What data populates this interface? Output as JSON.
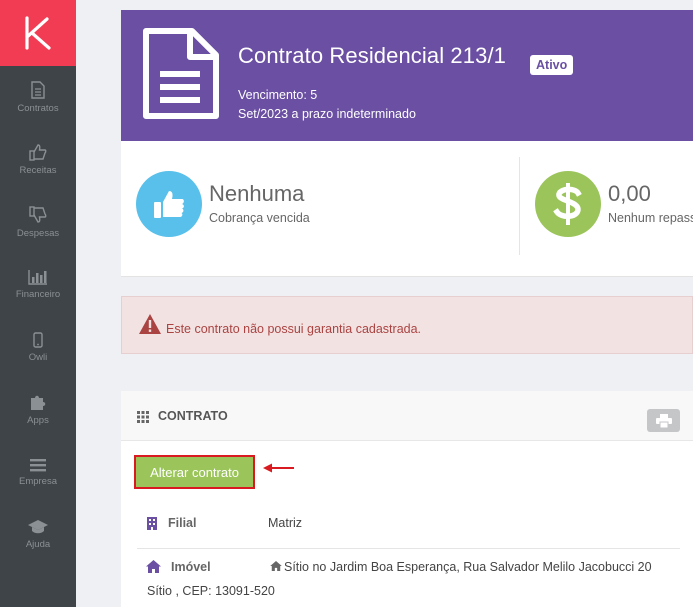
{
  "sidebar": {
    "items": [
      {
        "label": "Contratos",
        "icon": "document-icon"
      },
      {
        "label": "Receitas",
        "icon": "thumbs-up-icon"
      },
      {
        "label": "Despesas",
        "icon": "thumbs-down-icon"
      },
      {
        "label": "Financeiro",
        "icon": "bar-chart-icon"
      },
      {
        "label": "Owli",
        "icon": "mobile-icon"
      },
      {
        "label": "Apps",
        "icon": "puzzle-icon"
      },
      {
        "label": "Empresa",
        "icon": "menu-icon"
      },
      {
        "label": "Ajuda",
        "icon": "graduation-cap-icon"
      }
    ]
  },
  "header": {
    "title": "Contrato Residencial 213/1",
    "status": "Ativo",
    "vencimento": "Vencimento: 5",
    "periodo": "Set/2023 a prazo indeterminado"
  },
  "stats": [
    {
      "value": "Nenhuma",
      "label": "Cobrança vencida"
    },
    {
      "value": "0,00",
      "label": "Nenhum repass"
    }
  ],
  "alert": {
    "text": "Este contrato não possui garantia cadastrada."
  },
  "contract": {
    "title": "CONTRATO",
    "alter_button": "Alterar contrato",
    "filial_label": "Filial",
    "filial_value": "Matriz",
    "imovel_label": "Imóvel",
    "imovel_value_line1": "Sítio no Jardim Boa Esperança, Rua Salvador Melilo Jacobucci 20",
    "imovel_value_line2": "Sítio , CEP: 13091-520"
  },
  "colors": {
    "sidebar": "#3e4447",
    "logo": "#f23c53",
    "header": "#6a4fa3",
    "stat1": "#58c0ea",
    "stat2": "#9bc55b",
    "alert_text": "#a94442",
    "button": "#9bc55b",
    "highlight": "#d91a20"
  }
}
